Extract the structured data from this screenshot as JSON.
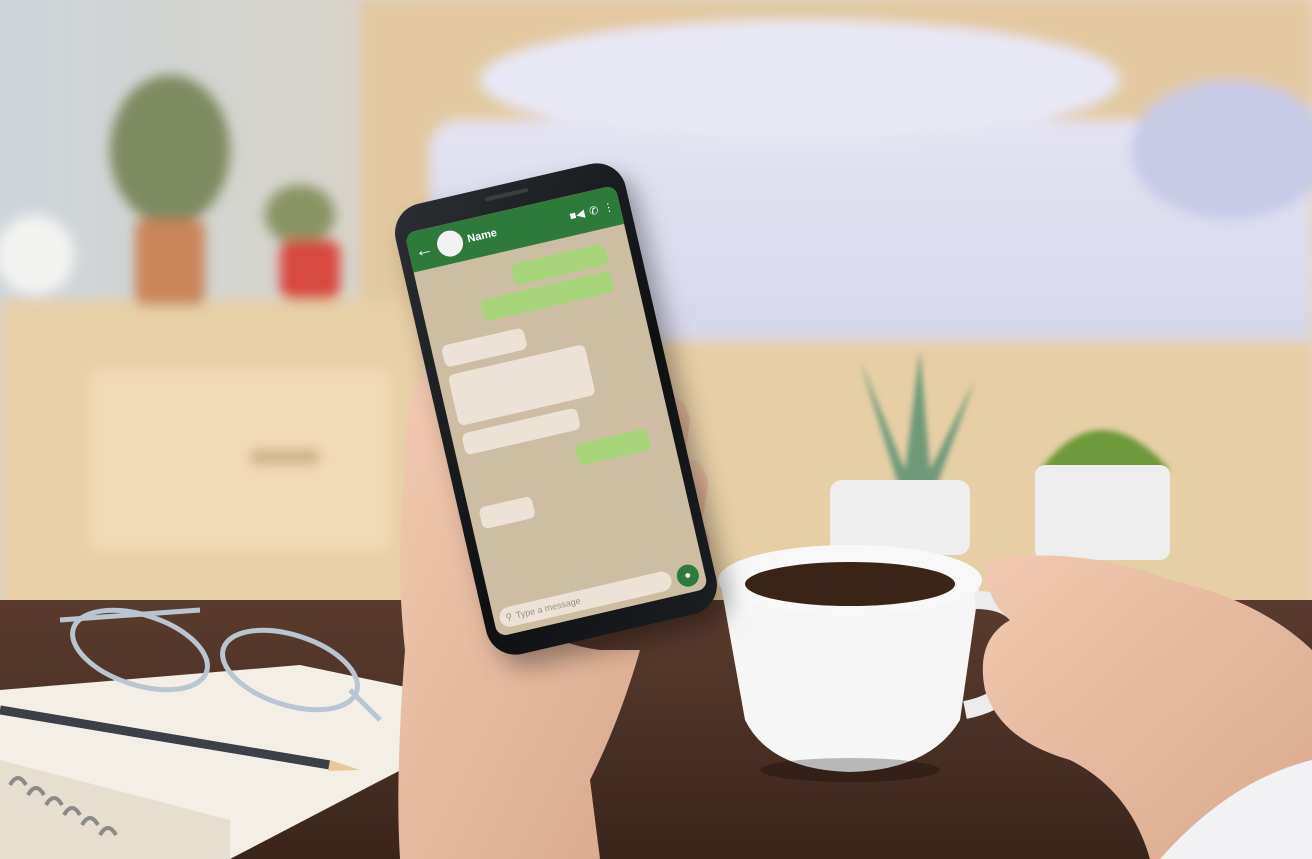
{
  "chat": {
    "contact_name": "Name",
    "back_icon": "arrow-left-icon",
    "header_icons": [
      "video-icon",
      "phone-icon",
      "more-icon"
    ],
    "input_placeholder": "Type a message",
    "mic_icon": "mic-icon",
    "messages": [
      {
        "side": "out"
      },
      {
        "side": "out"
      },
      {
        "side": "in"
      },
      {
        "side": "in"
      },
      {
        "side": "in"
      },
      {
        "side": "out"
      },
      {
        "side": "in"
      }
    ]
  },
  "colors": {
    "header_green": "#2e7a3b",
    "outgoing_bubble": "#a7d47a",
    "incoming_bubble": "#ece3d6",
    "chat_background": "#cdbda3"
  }
}
